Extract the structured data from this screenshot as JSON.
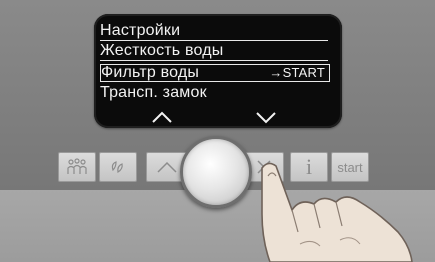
{
  "display": {
    "menu": [
      {
        "label": "Настройки"
      },
      {
        "label": "Жесткость воды"
      },
      {
        "label": "Фильтр воды",
        "action": "→START",
        "selected": true
      },
      {
        "label": "Трансп. замок"
      }
    ],
    "nav": [
      "chevron-up-icon",
      "chevron-down-icon"
    ]
  },
  "buttons": {
    "family_icon": "family-icon",
    "care_icon": "care-icon",
    "up_icon": "chevron-up-icon",
    "down_icon": "x-mark-icon",
    "info_label": "i",
    "start_label": "start"
  },
  "colors": {
    "display_bg": "#0b0b0b",
    "display_text": "#f2f2f2",
    "panel": "#7d7d7d"
  }
}
